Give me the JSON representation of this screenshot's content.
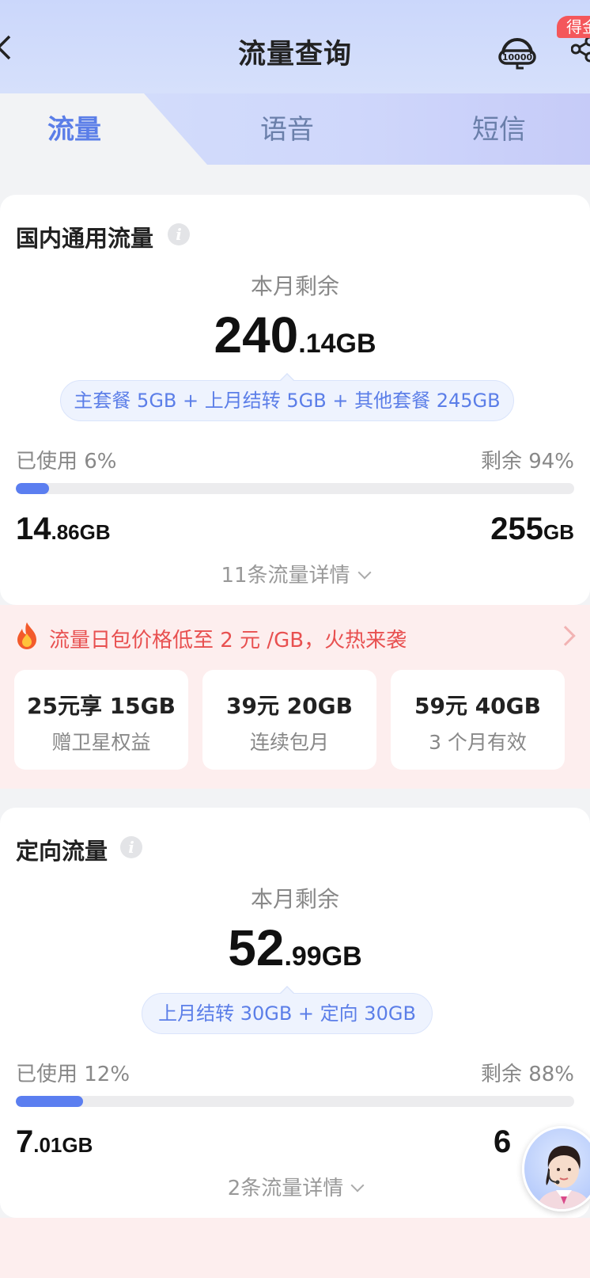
{
  "header": {
    "title": "流量查询",
    "badge": "得金"
  },
  "tabs": [
    {
      "label": "流量",
      "active": true
    },
    {
      "label": "语音",
      "active": false
    },
    {
      "label": "短信",
      "active": false
    }
  ],
  "domestic": {
    "title": "国内通用流量",
    "remain_label": "本月剩余",
    "remain_int": "240",
    "remain_dec": ".14GB",
    "breakdown": "主套餐 5GB + 上月结转 5GB + 其他套餐 245GB",
    "used_label": "已使用 6%",
    "left_label": "剩余 94%",
    "used_percent": 6,
    "used_int": "14",
    "used_dec": ".86GB",
    "total_int": "255",
    "total_unit": "GB",
    "detail_link": "11条流量详情"
  },
  "promo": {
    "headline": "流量日包价格低至 2 元 /GB，火热来袭",
    "offers": [
      {
        "title": "25元享 15GB",
        "sub": "赠卫星权益"
      },
      {
        "title": "39元 20GB",
        "sub": "连续包月"
      },
      {
        "title": "59元 40GB",
        "sub": "3 个月有效"
      }
    ]
  },
  "directed": {
    "title": "定向流量",
    "remain_label": "本月剩余",
    "remain_int": "52",
    "remain_dec": ".99GB",
    "breakdown": "上月结转 30GB + 定向 30GB",
    "used_label": "已使用 12%",
    "left_label": "剩余 88%",
    "used_percent": 12,
    "used_int": "7",
    "used_dec": ".01GB",
    "total_int": "6",
    "detail_link": "2条流量详情"
  },
  "colors": {
    "accent": "#5b7ee8",
    "bar_fill": "#5b7ef0",
    "promo_text": "#e85050",
    "badge": "#f4575b"
  },
  "icons": {
    "back": "chevron-left-icon",
    "hotline": "hotline-10000-icon",
    "share": "share-icon",
    "info": "info-icon",
    "fire": "fire-icon",
    "expand": "chevron-down-icon",
    "promo_more": "chevron-right-icon"
  }
}
